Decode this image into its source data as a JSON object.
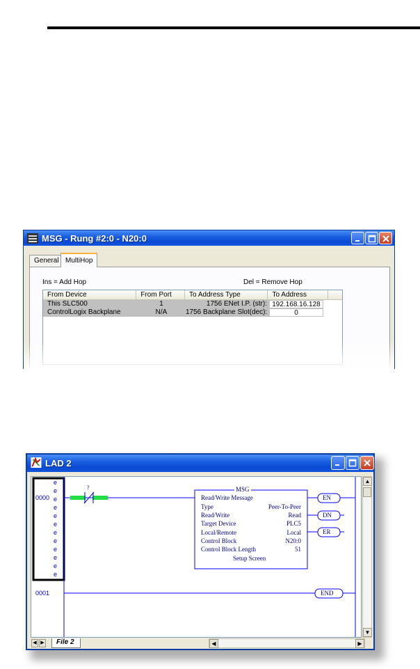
{
  "msg_window": {
    "title": "MSG - Rung #2:0 - N20:0",
    "tabs": [
      {
        "label": "General",
        "active": false
      },
      {
        "label": "MultiHop",
        "active": true
      }
    ],
    "hint_insert": "Ins = Add Hop",
    "hint_delete": "Del = Remove Hop",
    "columns": [
      "From Device",
      "From Port",
      "To Address Type",
      "To Address"
    ],
    "rows": [
      {
        "from_device": "This SLC500",
        "from_port": "1",
        "to_address_type": "1756 ENet I.P. (str):",
        "to_address": "192.168.16.128"
      },
      {
        "from_device": "ControlLogix Backplane",
        "from_port": "N/A",
        "to_address_type": "1756 Backplane Slot(dec):",
        "to_address": "0"
      }
    ]
  },
  "lad_window": {
    "title": "LAD 2",
    "file_tab": "File 2",
    "rungs": [
      {
        "number": "0000",
        "instruction": "MSG"
      },
      {
        "number": "0001",
        "instruction": "END"
      }
    ],
    "contact_label": "?",
    "rail_marker": "e",
    "msg_block": {
      "header": "MSG",
      "title": "Read/Write Message",
      "params": [
        {
          "label": "Type",
          "value": "Peer-To-Peer"
        },
        {
          "label": "Read/Write",
          "value": "Read"
        },
        {
          "label": "Target Device",
          "value": "PLC5"
        },
        {
          "label": "Local/Remote",
          "value": "Local"
        },
        {
          "label": "Control Block",
          "value": "N20:0"
        },
        {
          "label": "Control Block Length",
          "value": "51"
        }
      ],
      "setup": "Setup Screen",
      "outputs": [
        "EN",
        "DN",
        "ER"
      ]
    },
    "end_label": "END"
  },
  "colors": {
    "xp_title_blue": "#0a48d2",
    "contact_green": "#22dd44",
    "rung_blue": "#0000ff",
    "text_navy": "#00008b"
  }
}
